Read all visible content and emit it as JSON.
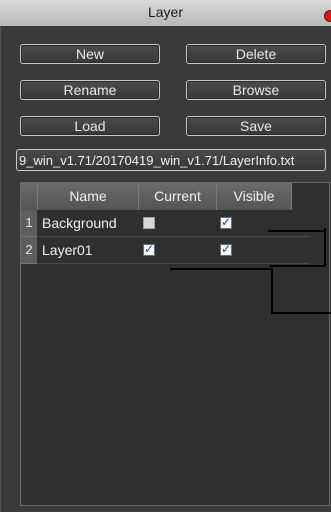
{
  "window": {
    "title": "Layer"
  },
  "buttons": {
    "new": "New",
    "delete": "Delete",
    "rename": "Rename",
    "browse": "Browse",
    "load": "Load",
    "save": "Save"
  },
  "path_field": {
    "value": "9_win_v1.71/20170419_win_v1.71/LayerInfo.txt"
  },
  "table": {
    "columns": [
      "Name",
      "Current",
      "Visible"
    ],
    "rows": [
      {
        "index": "1",
        "name": "Background",
        "current": false,
        "visible": true
      },
      {
        "index": "2",
        "name": "Layer01",
        "current": true,
        "visible": true
      }
    ]
  }
}
